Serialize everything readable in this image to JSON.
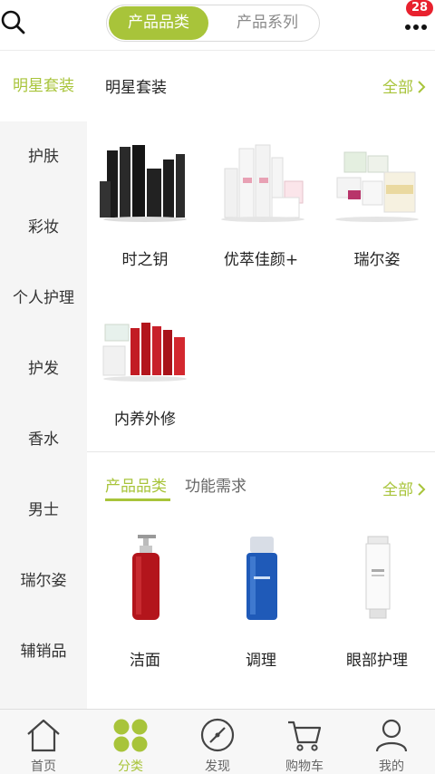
{
  "header": {
    "tabs": [
      {
        "label": "产品品类",
        "active": true
      },
      {
        "label": "产品系列",
        "active": false
      }
    ],
    "badge_count": "28",
    "icons": {
      "search": "search-icon",
      "more": "more-dots-icon"
    }
  },
  "sidebar": {
    "items": [
      {
        "label": "明星套装",
        "active": true
      },
      {
        "label": "护肤",
        "active": false
      },
      {
        "label": "彩妆",
        "active": false
      },
      {
        "label": "个人护理",
        "active": false
      },
      {
        "label": "护发",
        "active": false
      },
      {
        "label": "香水",
        "active": false
      },
      {
        "label": "男士",
        "active": false
      },
      {
        "label": "瑞尔姿",
        "active": false
      },
      {
        "label": "辅销品",
        "active": false
      }
    ]
  },
  "main": {
    "section1": {
      "title": "明星套装",
      "all_label": "全部",
      "products": [
        {
          "name": "时之钥",
          "image": "dark-skincare-set"
        },
        {
          "name": "优萃佳颜+",
          "image": "white-pink-skincare-set"
        },
        {
          "name": "瑞尔姿",
          "image": "tub-jar-set"
        },
        {
          "name": "内养外修",
          "image": "red-supplement-set"
        }
      ]
    },
    "section2": {
      "tabs": [
        {
          "label": "产品品类",
          "active": true
        },
        {
          "label": "功能需求",
          "active": false
        }
      ],
      "all_label": "全部",
      "products": [
        {
          "name": "洁面",
          "image": "red-pump-bottle"
        },
        {
          "name": "调理",
          "image": "blue-toner-bottle"
        },
        {
          "name": "眼部护理",
          "image": "white-eye-cream-tube"
        }
      ]
    }
  },
  "bottom_nav": {
    "items": [
      {
        "label": "首页",
        "icon": "home-icon",
        "active": false
      },
      {
        "label": "分类",
        "icon": "category-icon",
        "active": true
      },
      {
        "label": "发现",
        "icon": "compass-icon",
        "active": false
      },
      {
        "label": "购物车",
        "icon": "cart-icon",
        "active": false
      },
      {
        "label": "我的",
        "icon": "user-icon",
        "active": false
      }
    ]
  },
  "colors": {
    "accent": "#a8c43a",
    "badge": "#e8212e",
    "sidebar_bg": "#f5f5f5"
  }
}
